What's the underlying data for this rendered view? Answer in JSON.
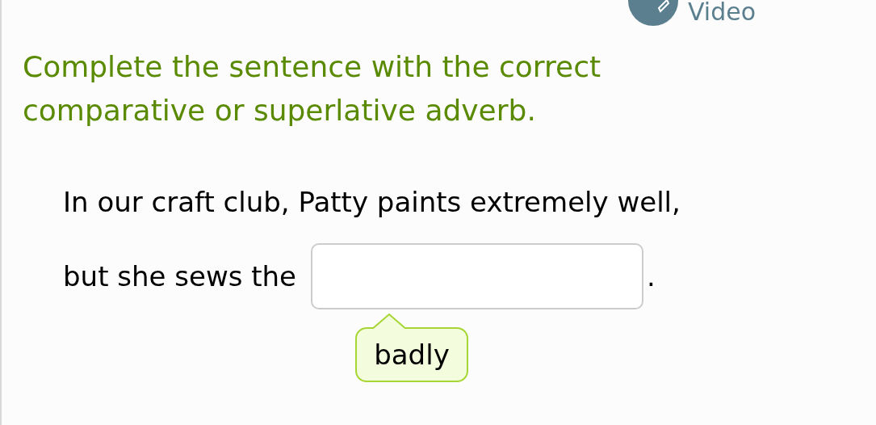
{
  "video_button": {
    "label": "Video"
  },
  "instruction": "Complete the sentence with the correct comparative or superlative adverb.",
  "sentence": {
    "line_1": "In our craft club, Patty paints extremely well,",
    "before_blank": "but she sews the",
    "after_blank": "."
  },
  "hint": {
    "text": "badly"
  }
}
